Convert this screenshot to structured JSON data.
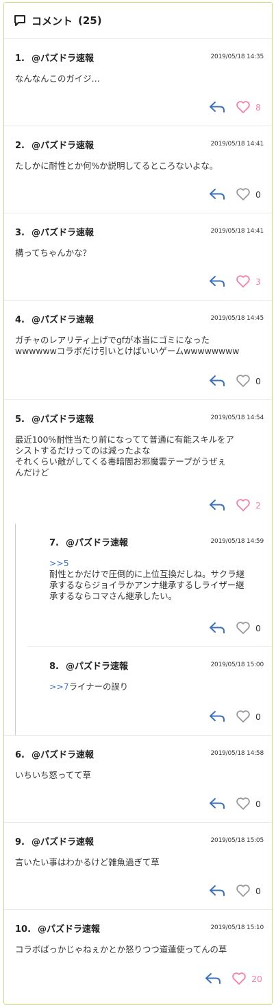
{
  "header": {
    "title": "コメント",
    "count": "(25)",
    "icon": "comment-icon"
  },
  "colors": {
    "frame_border": "#c8e07a",
    "reply_icon": "#3c71b8",
    "liked_heart": "#f57fa9",
    "heart_outline": "#999999"
  },
  "comments": [
    {
      "num": "1.",
      "author": "@パズドラ速報",
      "date": "2019/05/18 14:35",
      "lines": [
        "なんなんこのガイジ…"
      ],
      "likes": "8",
      "liked": true
    },
    {
      "num": "2.",
      "author": "@パズドラ速報",
      "date": "2019/05/18 14:41",
      "lines": [
        "たしかに耐性とか何%か説明してるところないよな。"
      ],
      "likes": "0",
      "liked": false
    },
    {
      "num": "3.",
      "author": "@パズドラ速報",
      "date": "2019/05/18 14:41",
      "lines": [
        "構ってちゃんかな？"
      ],
      "likes": "3",
      "liked": true
    },
    {
      "num": "4.",
      "author": "@パズドラ速報",
      "date": "2019/05/18 14:45",
      "lines": [
        "ガチャのレアリティ上げでgfが本当にゴミになった",
        "wwwwwwコラボだけ引いとけばいいゲームwwwwwwww"
      ],
      "likes": "0",
      "liked": false
    },
    {
      "num": "5.",
      "author": "@パズドラ速報",
      "date": "2019/05/18 14:54",
      "lines": [
        "最近100%耐性当たり前になってて普通に有能スキルをア",
        "シストするだけってのは減ったよな",
        "それくらい敵がしてくる毒暗闇お邪魔雲テープがうぜぇ",
        "んだけど"
      ],
      "likes": "2",
      "liked": true
    }
  ],
  "replies": [
    {
      "num": "7.",
      "author": "@パズドラ速報",
      "date": "2019/05/18 14:59",
      "quote": ">>5",
      "lines": [
        "耐性とかだけで圧倒的に上位互換だしね。サクラ継",
        "承するならジョイラかアンナ継承するしライザー継",
        "承するならコマさん継承したい。"
      ],
      "likes": "0",
      "liked": false
    },
    {
      "num": "8.",
      "author": "@パズドラ速報",
      "date": "2019/05/18 15:00",
      "quote": ">>7",
      "lines": [
        "ライナーの誤り"
      ],
      "likes": "0",
      "liked": false
    }
  ],
  "comments_after": [
    {
      "num": "6.",
      "author": "@パズドラ速報",
      "date": "2019/05/18 14:58",
      "lines": [
        "いちいち怒ってて草"
      ],
      "likes": "0",
      "liked": false
    },
    {
      "num": "9.",
      "author": "@パズドラ速報",
      "date": "2019/05/18 15:05",
      "lines": [
        "言いたい事はわかるけど雑魚過ぎて草"
      ],
      "likes": "0",
      "liked": false
    },
    {
      "num": "10.",
      "author": "@パズドラ速報",
      "date": "2019/05/18 15:10",
      "lines": [
        "コラボばっかじゃねぇかとか怒りつつ道蓮使ってんの草"
      ],
      "likes": "20",
      "liked": true
    }
  ]
}
